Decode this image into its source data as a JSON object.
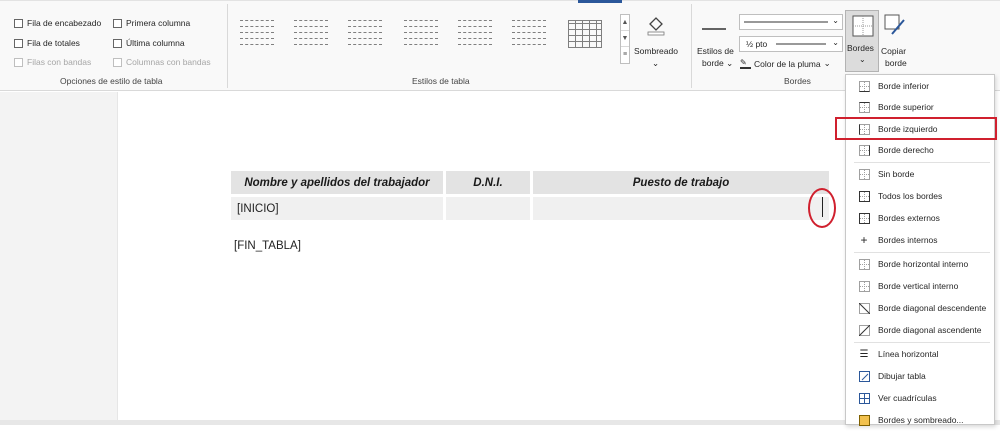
{
  "ribbon": {
    "options_group": {
      "checkboxes": [
        {
          "label": "Fila de encabezado",
          "checked": false,
          "disabled": false
        },
        {
          "label": "Primera columna",
          "checked": false,
          "disabled": false
        },
        {
          "label": "Fila de totales",
          "checked": false,
          "disabled": false
        },
        {
          "label": "Última columna",
          "checked": false,
          "disabled": false
        },
        {
          "label": "Filas con bandas",
          "checked": false,
          "disabled": true
        },
        {
          "label": "Columnas con bandas",
          "checked": false,
          "disabled": true
        }
      ],
      "label": "Opciones de estilo de tabla"
    },
    "styles_group": {
      "label": "Estilos de tabla",
      "shading_label": "Sombreado"
    },
    "borders_group": {
      "label": "Bordes",
      "border_styles_label_line1": "Estilos de",
      "border_styles_label_line2": "borde",
      "pen_weight": "½ pto",
      "pen_color_label": "Color de la pluma",
      "bordes_button": "Bordes",
      "copy_border_line1": "Copiar",
      "copy_border_line2": "borde"
    }
  },
  "document": {
    "table": {
      "headers": [
        "Nombre y apellidos del trabajador",
        "D.N.I.",
        "Puesto de trabajo"
      ],
      "rows": [
        [
          "[INICIO]",
          "",
          ""
        ]
      ]
    },
    "end_marker": "[FIN_TABLA]"
  },
  "border_menu": {
    "items": [
      {
        "label": "Borde inferior",
        "icon": "bottom-border-icon"
      },
      {
        "label": "Borde superior",
        "icon": "top-border-icon"
      },
      {
        "label": "Borde izquierdo",
        "icon": "left-border-icon",
        "highlighted": true
      },
      {
        "label": "Borde derecho",
        "icon": "right-border-icon"
      },
      {
        "label": "Sin borde",
        "icon": "no-border-icon"
      },
      {
        "label": "Todos los bordes",
        "icon": "all-borders-icon"
      },
      {
        "label": "Bordes externos",
        "icon": "outside-borders-icon"
      },
      {
        "label": "Bordes internos",
        "icon": "inside-borders-icon"
      },
      {
        "label": "Borde horizontal interno",
        "icon": "inside-horizontal-border-icon"
      },
      {
        "label": "Borde vertical interno",
        "icon": "inside-vertical-border-icon"
      },
      {
        "label": "Borde diagonal descendente",
        "icon": "diagonal-down-border-icon"
      },
      {
        "label": "Borde diagonal ascendente",
        "icon": "diagonal-up-border-icon"
      },
      {
        "label": "Línea horizontal",
        "icon": "horizontal-line-icon"
      },
      {
        "label": "Dibujar tabla",
        "icon": "draw-table-icon"
      },
      {
        "label": "Ver cuadrículas",
        "icon": "view-gridlines-icon"
      },
      {
        "label": "Bordes y sombreado...",
        "icon": "borders-shading-icon"
      }
    ]
  },
  "colors": {
    "highlight_red": "#d0202e",
    "ribbon_bg": "#f9f9f9",
    "header_cell": "#e3e3e3"
  }
}
